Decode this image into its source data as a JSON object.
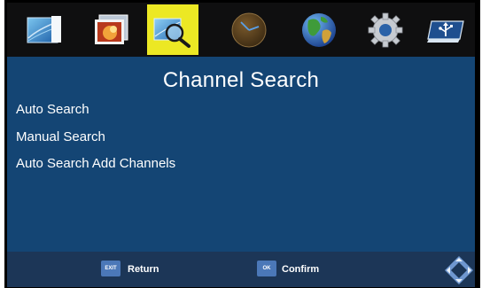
{
  "tabs": [
    {
      "icon": "picture-icon",
      "active": false
    },
    {
      "icon": "photo-icon",
      "active": false
    },
    {
      "icon": "channel-search-icon",
      "active": true
    },
    {
      "icon": "clock-icon",
      "active": false
    },
    {
      "icon": "globe-icon",
      "active": false
    },
    {
      "icon": "settings-gear-icon",
      "active": false
    },
    {
      "icon": "usb-icon",
      "active": false
    }
  ],
  "page": {
    "title": "Channel Search"
  },
  "menu": {
    "items": [
      {
        "label": "Auto Search"
      },
      {
        "label": "Manual Search"
      },
      {
        "label": "Auto Search Add Channels"
      }
    ]
  },
  "footer": {
    "exit_key": "EXIT",
    "return_label": "Return",
    "ok_key": "OK",
    "confirm_label": "Confirm",
    "nav_icon": "dpad-icon"
  },
  "colors": {
    "panel": "#144574",
    "footer": "#1c3657",
    "active_tab": "#ece824",
    "key": "#4b78b8"
  }
}
